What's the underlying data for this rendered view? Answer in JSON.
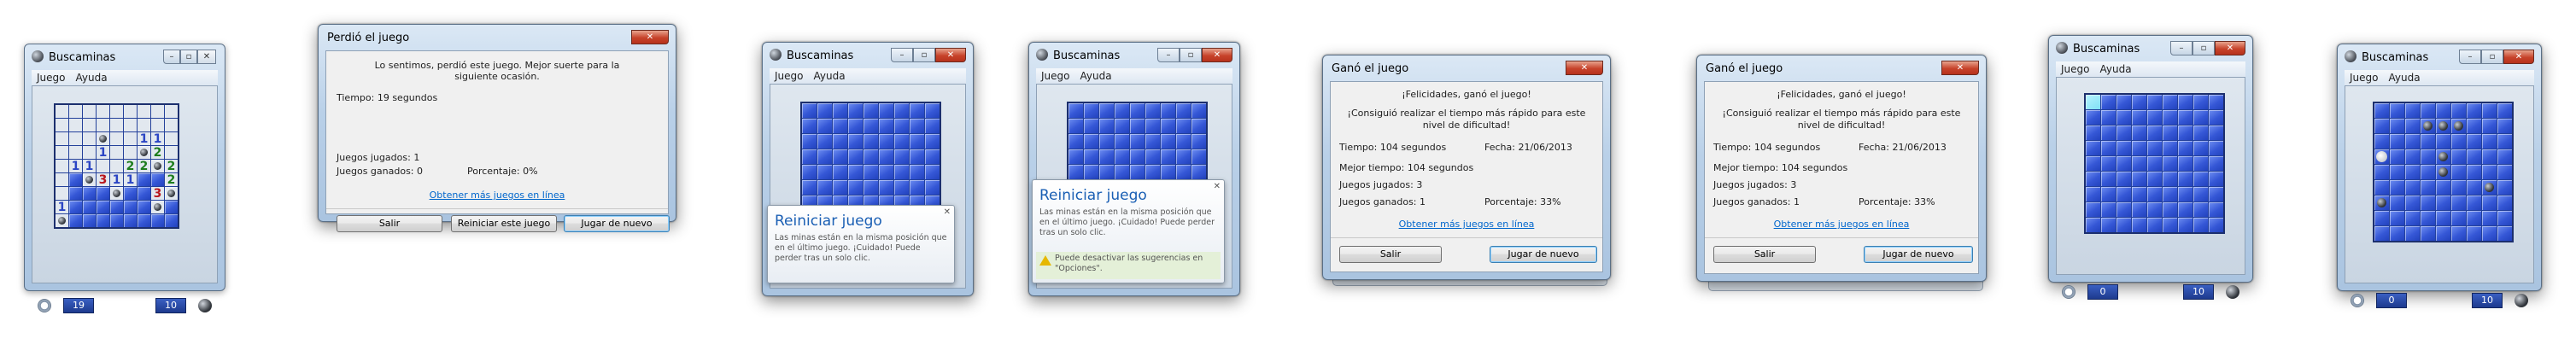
{
  "colors": {
    "board_blue": "#3557d6",
    "link_blue": "#0066cc",
    "close_red": "#c7432b",
    "num1": "#2b45c4",
    "num2": "#1e7d1e",
    "num3": "#b8161c"
  },
  "game_window": {
    "title": "Buscaminas",
    "menu": [
      "Juego",
      "Ayuda"
    ],
    "caption_buttons": [
      "minimize-icon",
      "maximize-icon",
      "close-icon"
    ]
  },
  "win1": {
    "time": "19",
    "mines": "10"
  },
  "lost_dialog": {
    "title": "Perdió el juego",
    "message": "Lo sentimos, perdió este juego. Mejor suerte para la siguiente ocasión.",
    "time": "Tiempo: 19 segundos",
    "played": "Juegos jugados: 1",
    "won": "Juegos ganados: 0",
    "percent": "Porcentaje: 0%",
    "link": "Obtener más juegos en línea",
    "btn_exit": "Salir",
    "btn_restart": "Reiniciar este juego",
    "btn_again": "Jugar de nuevo"
  },
  "tip1": {
    "title": "Reiniciar juego",
    "body": "Las minas están en la misma posición que en el último juego. ¡Cuidado! Puede perder tras un solo clic."
  },
  "tip2": {
    "title": "Reiniciar juego",
    "body": "Las minas están en la misma posición que en el último juego. ¡Cuidado! Puede perder tras un solo clic.",
    "warning": "Puede desactivar las sugerencias en \"Opciones\"."
  },
  "won_dialog": {
    "title": "Ganó el juego",
    "congrats": "¡Felicidades, ganó el juego!",
    "record": "¡Consiguió realizar el tiempo más rápido para este nivel de dificultad!",
    "time": "Tiempo: 104 segundos",
    "date": "Fecha: 21/06/2013",
    "best": "Mejor tiempo: 104 segundos",
    "played": "Juegos jugados: 3",
    "won": "Juegos ganados: 1",
    "percent": "Porcentaje: 33%",
    "link": "Obtener más juegos en línea",
    "btn_exit": "Salir",
    "btn_again": "Jugar de nuevo"
  },
  "win7": {
    "time": "0",
    "mines": "10"
  },
  "win8": {
    "time": "0",
    "mines": "10"
  }
}
